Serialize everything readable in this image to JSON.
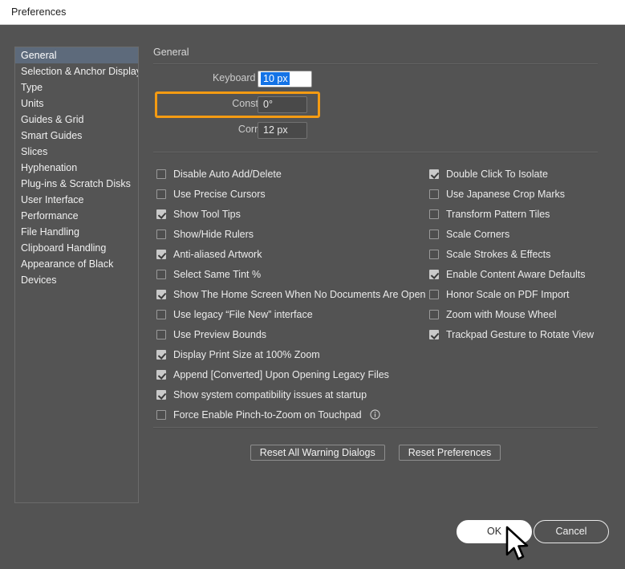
{
  "window": {
    "title": "Preferences"
  },
  "sidebar": {
    "items": [
      {
        "label": "General",
        "selected": true
      },
      {
        "label": "Selection & Anchor Display",
        "selected": false
      },
      {
        "label": "Type",
        "selected": false
      },
      {
        "label": "Units",
        "selected": false
      },
      {
        "label": "Guides & Grid",
        "selected": false
      },
      {
        "label": "Smart Guides",
        "selected": false
      },
      {
        "label": "Slices",
        "selected": false
      },
      {
        "label": "Hyphenation",
        "selected": false
      },
      {
        "label": "Plug-ins & Scratch Disks",
        "selected": false
      },
      {
        "label": "User Interface",
        "selected": false
      },
      {
        "label": "Performance",
        "selected": false
      },
      {
        "label": "File Handling",
        "selected": false
      },
      {
        "label": "Clipboard Handling",
        "selected": false
      },
      {
        "label": "Appearance of Black",
        "selected": false
      },
      {
        "label": "Devices",
        "selected": false
      }
    ]
  },
  "panel": {
    "title": "General",
    "fields": {
      "keyboard_increment": {
        "label": "Keyboard Increment:",
        "value": "10 px",
        "focused": true,
        "selected_text": true
      },
      "constrain_angle": {
        "label": "Constrain Angle:",
        "value": "0°",
        "focused": false
      },
      "corner_radius": {
        "label": "Corner Radius:",
        "value": "12 px",
        "focused": false
      }
    },
    "checkboxes_left": [
      {
        "label": "Disable Auto Add/Delete",
        "checked": false
      },
      {
        "label": "Use Precise Cursors",
        "checked": false
      },
      {
        "label": "Show Tool Tips",
        "checked": true
      },
      {
        "label": "Show/Hide Rulers",
        "checked": false
      },
      {
        "label": "Anti-aliased Artwork",
        "checked": true
      },
      {
        "label": "Select Same Tint %",
        "checked": false
      },
      {
        "label": "Show The Home Screen When No Documents Are Open",
        "checked": true
      },
      {
        "label": "Use legacy “File New” interface",
        "checked": false
      },
      {
        "label": "Use Preview Bounds",
        "checked": false
      },
      {
        "label": "Display Print Size at 100% Zoom",
        "checked": true
      },
      {
        "label": "Append [Converted] Upon Opening Legacy Files",
        "checked": true
      },
      {
        "label": "Show system compatibility issues at startup",
        "checked": true
      },
      {
        "label": "Force Enable Pinch-to-Zoom on Touchpad",
        "checked": false,
        "info": "info-icon"
      }
    ],
    "checkboxes_right": [
      {
        "label": "Double Click To Isolate",
        "checked": true
      },
      {
        "label": "Use Japanese Crop Marks",
        "checked": false
      },
      {
        "label": "Transform Pattern Tiles",
        "checked": false
      },
      {
        "label": "Scale Corners",
        "checked": false
      },
      {
        "label": "Scale Strokes & Effects",
        "checked": false
      },
      {
        "label": "Enable Content Aware Defaults",
        "checked": true
      },
      {
        "label": "Honor Scale on PDF Import",
        "checked": false
      },
      {
        "label": "Zoom with Mouse Wheel",
        "checked": false
      },
      {
        "label": "Trackpad Gesture to Rotate View",
        "checked": true
      }
    ],
    "reset_buttons": [
      {
        "label": "Reset All Warning Dialogs"
      },
      {
        "label": "Reset Preferences"
      }
    ]
  },
  "footer": {
    "ok_label": "OK",
    "cancel_label": "Cancel"
  },
  "colors": {
    "dialog_background": "#535353",
    "titlebar_background": "#ffffff",
    "focus_ring": "#f59b12",
    "selection_highlight": "#1473e6",
    "sidebar_selected": "#5d6a7b"
  },
  "cursor": {
    "icon": "mouse-pointer-icon"
  }
}
